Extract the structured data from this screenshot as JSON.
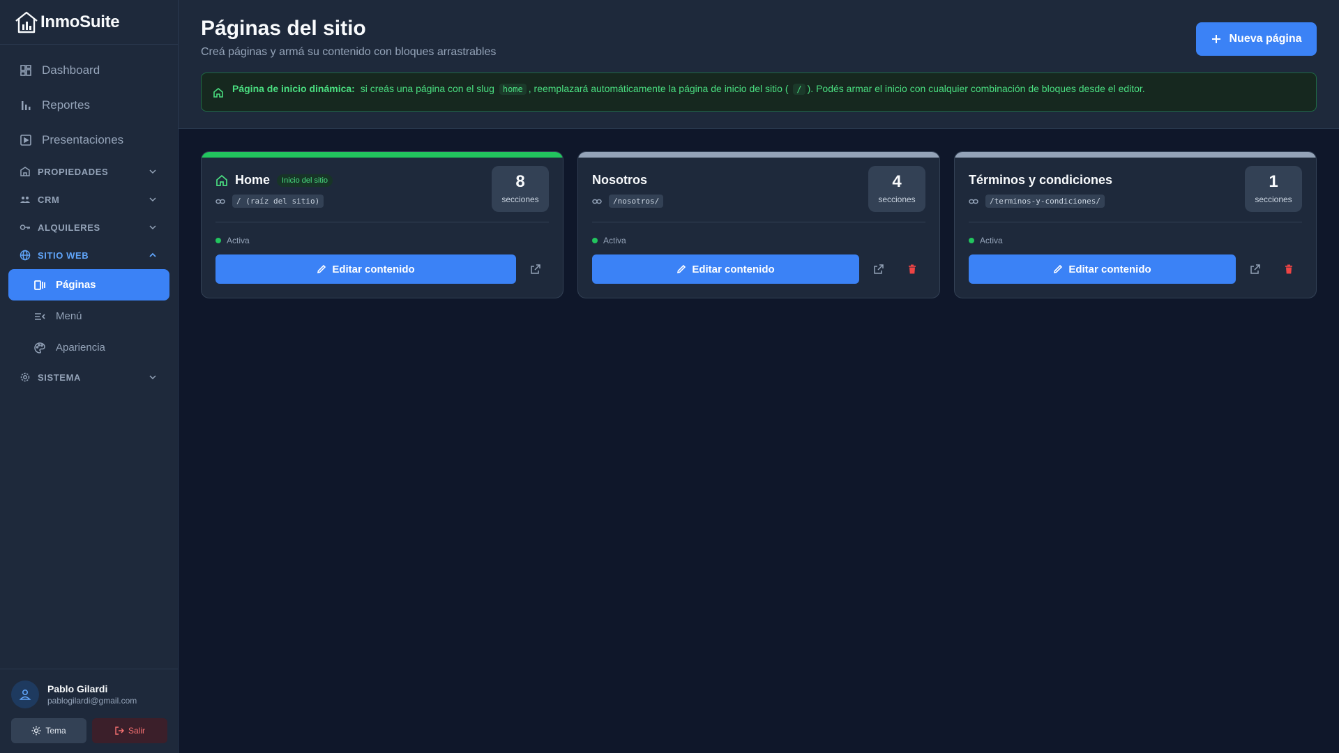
{
  "app": {
    "name": "InmoSuite"
  },
  "sidebar": {
    "items": [
      {
        "label": "Dashboard",
        "icon": "dashboard-icon"
      },
      {
        "label": "Reportes",
        "icon": "bar-chart-icon"
      },
      {
        "label": "Presentaciones",
        "icon": "play-icon"
      }
    ],
    "sections": [
      {
        "label": "PROPIEDADES",
        "icon": "building-icon",
        "open": false
      },
      {
        "label": "CRM",
        "icon": "users-icon",
        "open": false
      },
      {
        "label": "ALQUILERES",
        "icon": "key-icon",
        "open": false
      },
      {
        "label": "SITIO WEB",
        "icon": "globe-icon",
        "open": true
      },
      {
        "label": "SISTEMA",
        "icon": "settings-icon",
        "open": false
      }
    ],
    "web_items": [
      {
        "label": "Páginas",
        "icon": "pages-icon",
        "active": true
      },
      {
        "label": "Menú",
        "icon": "menu-icon",
        "active": false
      },
      {
        "label": "Apariencia",
        "icon": "palette-icon",
        "active": false
      }
    ]
  },
  "user": {
    "name": "Pablo Gilardi",
    "email": "pablogilardi@gmail.com",
    "theme_label": "Tema",
    "logout_label": "Salir"
  },
  "header": {
    "title": "Páginas del sitio",
    "subtitle": "Creá páginas y armá su contenido con bloques arrastrables",
    "new_button": "Nueva página"
  },
  "banner": {
    "bold": "Página de inicio dinámica:",
    "text1": "si creás una página con el slug",
    "slug": "home",
    "text2": ", reemplazará automáticamente la página de inicio del sitio (",
    "root": "/",
    "text3": "). Podés armar el inicio con cualquier combinación de bloques desde el editor."
  },
  "pages": [
    {
      "title": "Home",
      "badge": "Inicio del sitio",
      "slug": "/ (raíz del sitio)",
      "sections": "8",
      "sections_label": "secciones",
      "status": "Activa",
      "edit_label": "Editar contenido"
    },
    {
      "title": "Nosotros",
      "badge": "",
      "slug": "/nosotros/",
      "sections": "4",
      "sections_label": "secciones",
      "status": "Activa",
      "edit_label": "Editar contenido"
    },
    {
      "title": "Términos y condiciones",
      "badge": "",
      "slug": "/terminos-y-condiciones/",
      "sections": "1",
      "sections_label": "secciones",
      "status": "Activa",
      "edit_label": "Editar contenido"
    }
  ],
  "colors": {
    "accent": "#3b82f6",
    "success": "#22c55e",
    "danger": "#ef4444",
    "background": "#0f172a",
    "panel": "#1e293b"
  }
}
